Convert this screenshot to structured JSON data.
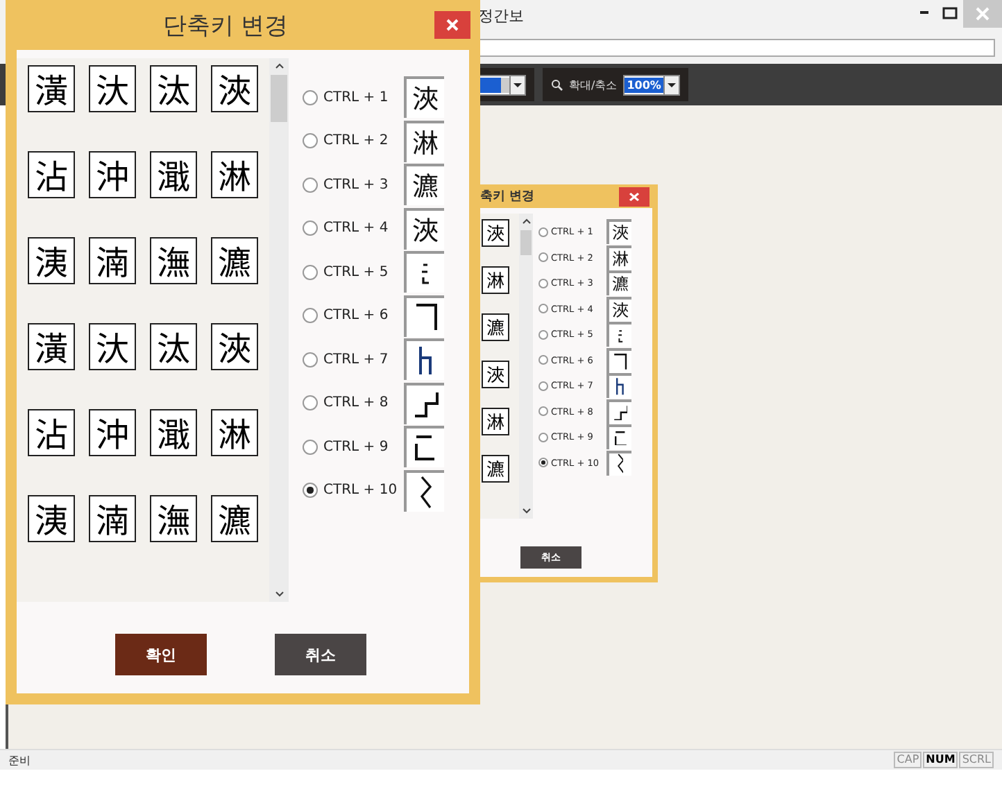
{
  "app": {
    "title": "정간보",
    "zoom_label": "확대/축소",
    "zoom_value": "100%",
    "status_text": "준비",
    "indicators": [
      {
        "label": "CAP",
        "on": false
      },
      {
        "label": "NUM",
        "on": true
      },
      {
        "label": "SCRL",
        "on": false
      }
    ]
  },
  "dialog_back": {
    "title": "축키 변경",
    "list_rows": [
      [
        "浹"
      ],
      [
        "淋"
      ],
      [
        "瀌"
      ],
      [
        "浹"
      ],
      [
        "淋"
      ],
      [
        "瀌"
      ]
    ],
    "shortcuts": [
      {
        "label": "CTRL + 1",
        "kind": "glyph",
        "preview": "浹",
        "selected": false
      },
      {
        "label": "CTRL + 2",
        "kind": "glyph",
        "preview": "淋",
        "selected": false
      },
      {
        "label": "CTRL + 3",
        "kind": "glyph",
        "preview": "瀌",
        "selected": false
      },
      {
        "label": "CTRL + 4",
        "kind": "glyph",
        "preview": "浹",
        "selected": false
      },
      {
        "label": "CTRL + 5",
        "kind": "dots",
        "selected": false
      },
      {
        "label": "CTRL + 6",
        "kind": "corner",
        "selected": false
      },
      {
        "label": "CTRL + 7",
        "kind": "hook",
        "selected": false
      },
      {
        "label": "CTRL + 8",
        "kind": "step",
        "selected": false
      },
      {
        "label": "CTRL + 9",
        "kind": "bracket",
        "selected": false
      },
      {
        "label": "CTRL + 10",
        "kind": "zigzag",
        "selected": true
      }
    ],
    "buttons": [
      {
        "label": "취소",
        "kind": "cancel"
      }
    ]
  },
  "dialog": {
    "title": "단축키 변경",
    "list_rows": [
      [
        "潢",
        "汏",
        "汰",
        "浹"
      ],
      [
        "沾",
        "沖",
        "濈",
        "淋"
      ],
      [
        "洟",
        "湳",
        "潕",
        "瀌"
      ],
      [
        "潢",
        "汏",
        "汰",
        "浹"
      ],
      [
        "沾",
        "沖",
        "濈",
        "淋"
      ],
      [
        "洟",
        "湳",
        "潕",
        "瀌"
      ]
    ],
    "shortcuts": [
      {
        "label": "CTRL + 1",
        "kind": "glyph",
        "preview": "浹",
        "selected": false
      },
      {
        "label": "CTRL + 2",
        "kind": "glyph",
        "preview": "淋",
        "selected": false
      },
      {
        "label": "CTRL + 3",
        "kind": "glyph",
        "preview": "瀌",
        "selected": false
      },
      {
        "label": "CTRL + 4",
        "kind": "glyph",
        "preview": "浹",
        "selected": false
      },
      {
        "label": "CTRL + 5",
        "kind": "dots",
        "selected": false
      },
      {
        "label": "CTRL + 6",
        "kind": "corner",
        "selected": false
      },
      {
        "label": "CTRL + 7",
        "kind": "hook",
        "selected": false
      },
      {
        "label": "CTRL + 8",
        "kind": "step",
        "selected": false
      },
      {
        "label": "CTRL + 9",
        "kind": "bracket",
        "selected": false
      },
      {
        "label": "CTRL + 10",
        "kind": "zigzag",
        "selected": true
      }
    ],
    "buttons": [
      {
        "label": "확인",
        "kind": "ok"
      },
      {
        "label": "취소",
        "kind": "cancel"
      }
    ]
  }
}
